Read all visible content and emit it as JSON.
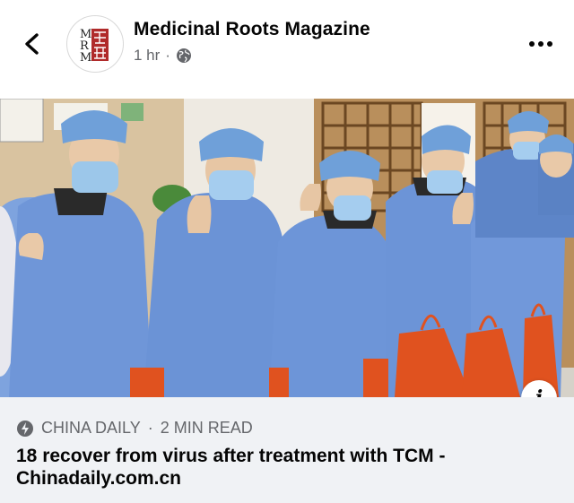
{
  "header": {
    "page_name": "Medicinal Roots Magazine",
    "timestamp": "1 hr",
    "separator": "·",
    "privacy_icon": "globe-icon",
    "avatar_letters": [
      "M",
      "R",
      "M"
    ],
    "back_icon": "chevron-left-icon",
    "more_icon": "ellipsis-icon"
  },
  "post": {
    "image_description": "Medical workers in blue protective gowns, caps and masks giving thumbs up, holding orange bags",
    "info_icon": "info-icon",
    "info_label": "i"
  },
  "link_card": {
    "source_icon": "lightning-icon",
    "source": "CHINA DAILY",
    "separator": "·",
    "read_time": "2 MIN READ",
    "headline": "18 recover from virus after treatment with TCM - Chinadaily.com.cn"
  },
  "colors": {
    "text_primary": "#050505",
    "text_secondary": "#65676b",
    "card_background": "#f0f2f5",
    "gown_blue": "#6f96d8",
    "bag_orange": "#e0521f",
    "seal_red": "#b02a2a"
  }
}
